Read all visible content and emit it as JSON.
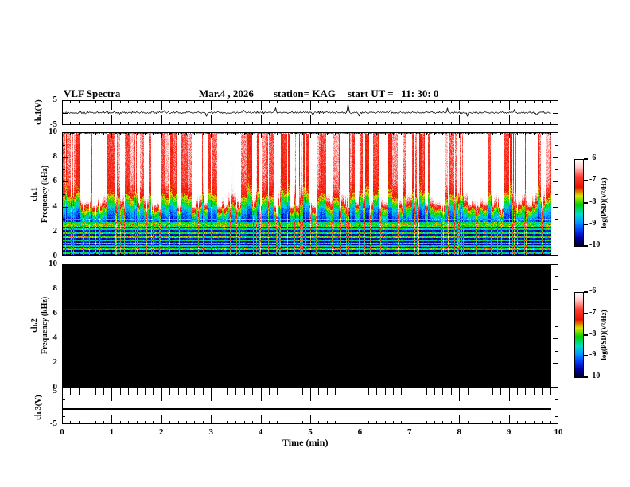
{
  "chart_data": {
    "type": "heatmap",
    "title": "VLF Spectra",
    "header": {
      "date": "Mar.4 , 2026",
      "station": "station= KAG",
      "start_ut": "start UT =   11: 30: 0"
    },
    "x_axis": {
      "label": "Time (min)",
      "min": 0,
      "max": 10,
      "tick_labels": [
        "0",
        "1",
        "2",
        "3",
        "4",
        "5",
        "6",
        "7",
        "8",
        "9",
        "10"
      ],
      "minor_divisions": 6,
      "data_end_min": 9.85
    },
    "colorbar": {
      "label": "log(PSD)(V²/Hz)",
      "tick_labels": [
        "-6",
        "-7",
        "-8",
        "-9",
        "-10"
      ],
      "max": -6,
      "min": -10,
      "stops": [
        [
          0,
          "#ffffff"
        ],
        [
          0.09,
          "#ffc8c8"
        ],
        [
          0.2,
          "#ff3c32"
        ],
        [
          0.32,
          "#e61400"
        ],
        [
          0.42,
          "#d2e600"
        ],
        [
          0.52,
          "#00d200"
        ],
        [
          0.63,
          "#00dcc8"
        ],
        [
          0.72,
          "#009cff"
        ],
        [
          0.8,
          "#0046ff"
        ],
        [
          0.9,
          "#0000aa"
        ],
        [
          1,
          "#000022"
        ]
      ]
    },
    "panels": [
      {
        "id": "ch1_wave",
        "kind": "waveform",
        "ylabel": "ch.1(V)",
        "ytick_labels": [
          "5",
          "-5"
        ],
        "ymin": -5,
        "ymax": 5,
        "noise_amp": 0.45,
        "seed": 13,
        "spikes": [
          {
            "t": 0.35,
            "v": 0.9
          },
          {
            "t": 1.15,
            "v": -0.8
          },
          {
            "t": 2.05,
            "v": 0.8
          },
          {
            "t": 2.9,
            "v": -1.6
          },
          {
            "t": 3.65,
            "v": 0.9
          },
          {
            "t": 4.3,
            "v": 2.0
          },
          {
            "t": 5.05,
            "v": -1.0
          },
          {
            "t": 5.75,
            "v": 3.4
          },
          {
            "t": 5.97,
            "v": -1.7
          },
          {
            "t": 6.6,
            "v": 0.9
          },
          {
            "t": 7.75,
            "v": 1.9
          },
          {
            "t": 8.16,
            "v": -1.4
          },
          {
            "t": 9.1,
            "v": 1.5
          },
          {
            "t": 9.55,
            "v": -1.0
          }
        ]
      },
      {
        "id": "ch1_spec",
        "kind": "spectrogram",
        "ylabel_ch": "ch.1",
        "ylabel_axis": "Frequency (kHz)",
        "ytick_labels": [
          "10",
          "8",
          "6",
          "4",
          "2",
          "0"
        ],
        "fmin": 0,
        "fmax": 10,
        "seed": 42,
        "profile": [
          [
            0,
            -9.95
          ],
          [
            0.4,
            -9.75
          ],
          [
            1,
            -9.6
          ],
          [
            2,
            -9.55
          ],
          [
            3,
            -9.4
          ],
          [
            3.8,
            -8.9
          ],
          [
            4.3,
            -8.3
          ],
          [
            4.7,
            -7.9
          ],
          [
            5.2,
            -7.3
          ],
          [
            6,
            -7.0
          ],
          [
            8,
            -6.9
          ],
          [
            10,
            -6.85
          ]
        ],
        "h_lines": [
          [
            0.3,
            1.3
          ],
          [
            0.6,
            1.6
          ],
          [
            0.85,
            1.1
          ],
          [
            1.05,
            1.7
          ],
          [
            1.3,
            1.1
          ],
          [
            1.55,
            1.5
          ],
          [
            1.9,
            1.3
          ],
          [
            2.2,
            1.1
          ],
          [
            2.5,
            1.4
          ],
          [
            2.75,
            1.0
          ],
          [
            3.0,
            1.2
          ]
        ],
        "burst_prob": 0.45,
        "vline_prob": 0.16,
        "noise": 0.5
      },
      {
        "id": "ch2_spec",
        "kind": "spectrogram-quiet",
        "ylabel_ch": "ch.2",
        "ylabel_axis": "Frequency (kHz)",
        "ytick_labels": [
          "10",
          "8",
          "6",
          "4",
          "2",
          "0"
        ],
        "fmin": 0,
        "fmax": 10,
        "seed": 7,
        "bg_color": "#000000",
        "line_freq": 6.4,
        "line_color": "#0000aa"
      },
      {
        "id": "ch3_wave",
        "kind": "flatline",
        "ylabel": "ch.3(V)",
        "ytick_labels": [
          "5",
          "-5"
        ],
        "ymin": -5,
        "ymax": 5,
        "value": 0
      }
    ]
  }
}
